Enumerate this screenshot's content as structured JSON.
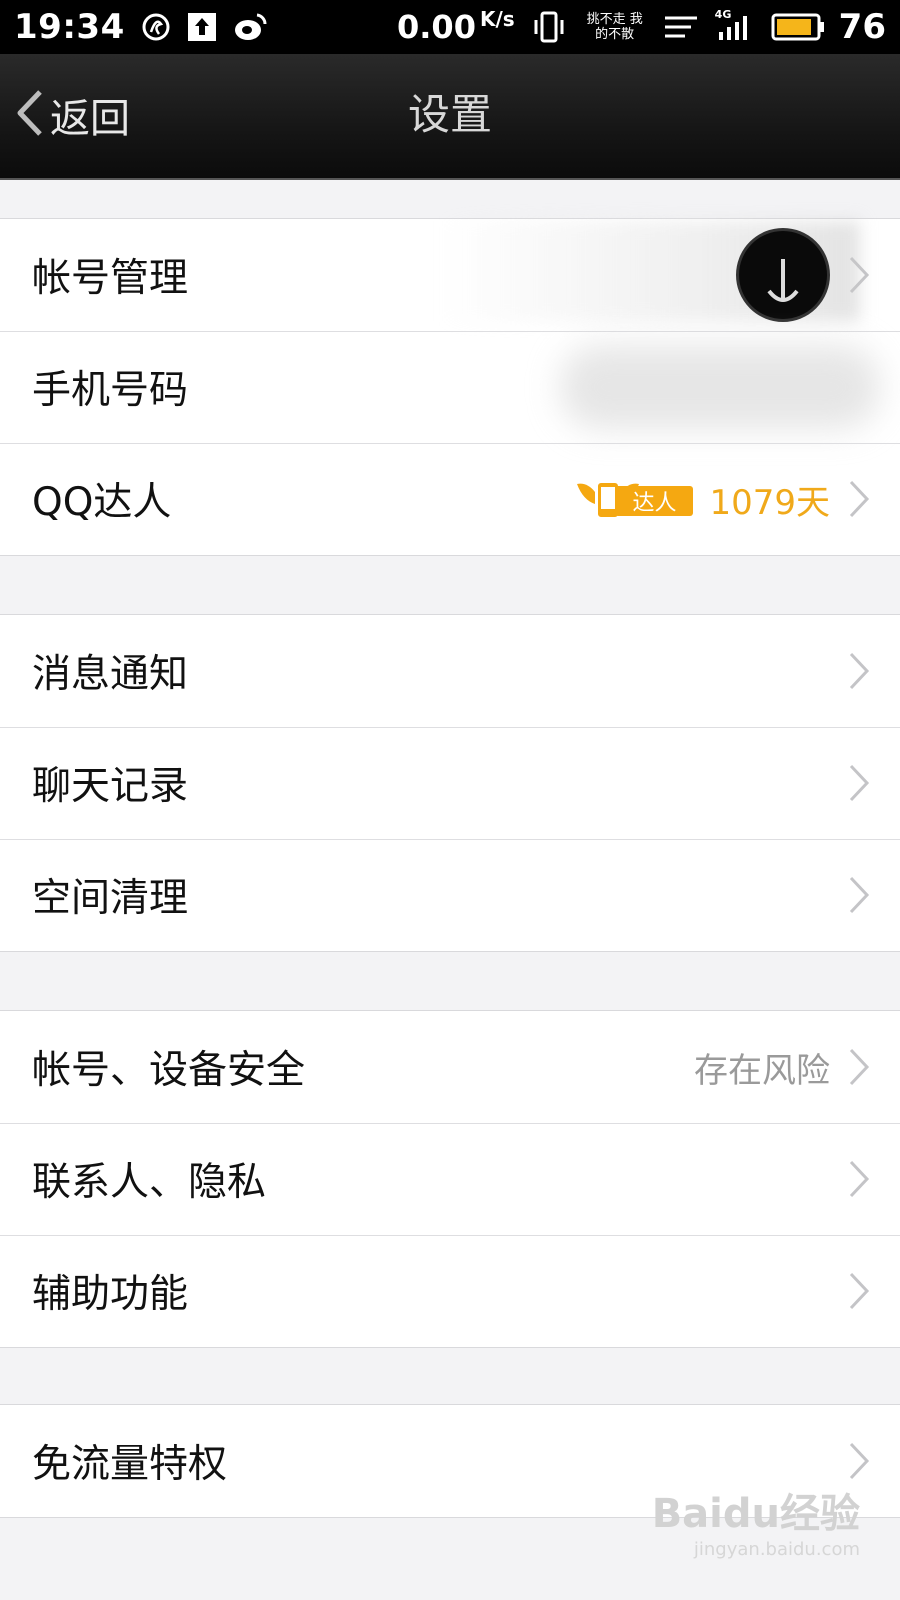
{
  "status_bar": {
    "time": "19:34",
    "net_speed": "0.00",
    "net_unit": "K/s",
    "network_type": "4G",
    "battery_level": "76",
    "carrier_text": "挑不走 我的不散"
  },
  "nav": {
    "back_label": "返回",
    "title": "设置"
  },
  "groups": [
    {
      "rows": [
        {
          "label": "帐号管理",
          "icon": "avatar"
        },
        {
          "label": "手机号码"
        },
        {
          "label": "QQ达人",
          "badge_text": "达人",
          "value": "1079天"
        }
      ]
    },
    {
      "rows": [
        {
          "label": "消息通知"
        },
        {
          "label": "聊天记录"
        },
        {
          "label": "空间清理"
        }
      ]
    },
    {
      "rows": [
        {
          "label": "帐号、设备安全",
          "value": "存在风险"
        },
        {
          "label": "联系人、隐私"
        },
        {
          "label": "辅助功能"
        }
      ]
    },
    {
      "rows": [
        {
          "label": "免流量特权"
        }
      ]
    }
  ],
  "watermark": {
    "text": "Baidu经验",
    "sub": "jingyan.baidu.com"
  },
  "colors": {
    "accent_gold": "#f0a91a",
    "separator": "#dedee1",
    "background": "#f3f3f5"
  }
}
